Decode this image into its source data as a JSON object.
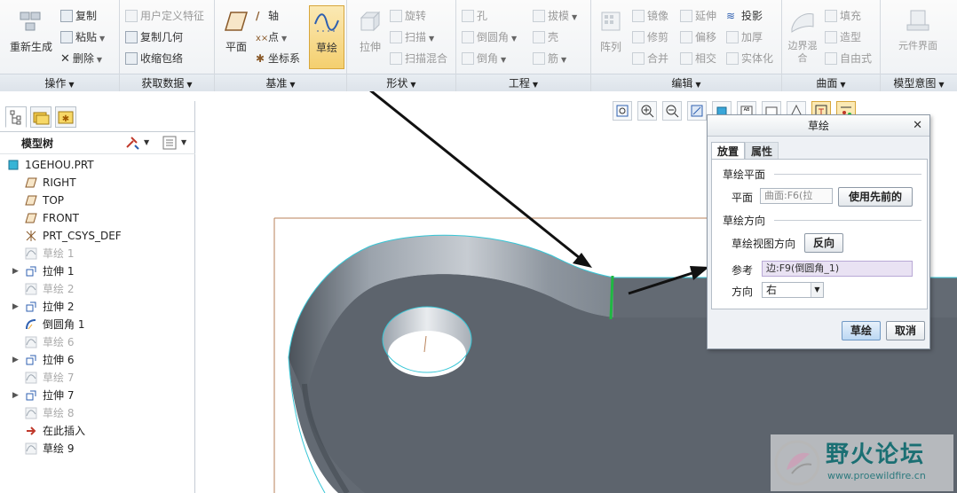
{
  "ribbon": {
    "groups": {
      "operations": "操作",
      "get_data": "获取数据",
      "datum": "基准",
      "shapes": "形状",
      "engineering": "工程",
      "editing": "编辑",
      "surfaces": "曲面",
      "model_intent": "模型意图"
    },
    "operations": {
      "regenerate": "重新生成",
      "copy": "复制",
      "paste": "粘贴",
      "delete": "删除"
    },
    "get_data": {
      "udf": "用户定义特征",
      "copy_geom": "复制几何",
      "shrinkwrap": "收缩包络"
    },
    "datum": {
      "plane": "平面",
      "axis": "轴",
      "point": "点",
      "csys": "坐标系",
      "sketch": "草绘"
    },
    "shapes": {
      "extrude": "拉伸",
      "revolve": "旋转",
      "sweep": "扫描",
      "swept_blend": "扫描混合"
    },
    "engineering": {
      "hole": "孔",
      "draft": "拔模",
      "round": "倒圆角",
      "shell": "壳",
      "chamfer": "倒角",
      "rib": "筋"
    },
    "editing": {
      "pattern": "阵列",
      "mirror": "镜像",
      "extend": "延伸",
      "project": "投影",
      "trim": "修剪",
      "offset": "偏移",
      "thicken": "加厚",
      "merge": "合并",
      "intersect": "相交",
      "solidify": "实体化"
    },
    "surfaces": {
      "boundary_blend": "边界混合",
      "fill": "填充",
      "style": "造型",
      "freestyle": "自由式"
    },
    "model_intent": {
      "component_interface": "元件界面"
    }
  },
  "model_tree": {
    "header": "模型树",
    "items": [
      {
        "label": "1GEHOU.PRT",
        "dim": false,
        "expandable": false
      },
      {
        "label": "RIGHT",
        "dim": false,
        "expandable": false
      },
      {
        "label": "TOP",
        "dim": false,
        "expandable": false
      },
      {
        "label": "FRONT",
        "dim": false,
        "expandable": false
      },
      {
        "label": "PRT_CSYS_DEF",
        "dim": false,
        "expandable": false
      },
      {
        "label": "草绘 1",
        "dim": true,
        "expandable": false
      },
      {
        "label": "拉伸 1",
        "dim": false,
        "expandable": true
      },
      {
        "label": "草绘 2",
        "dim": true,
        "expandable": false
      },
      {
        "label": "拉伸 2",
        "dim": false,
        "expandable": true
      },
      {
        "label": "倒圆角 1",
        "dim": false,
        "expandable": false
      },
      {
        "label": "草绘 6",
        "dim": true,
        "expandable": false
      },
      {
        "label": "拉伸 6",
        "dim": false,
        "expandable": true
      },
      {
        "label": "草绘 7",
        "dim": true,
        "expandable": false
      },
      {
        "label": "拉伸 7",
        "dim": false,
        "expandable": true
      },
      {
        "label": "草绘 8",
        "dim": true,
        "expandable": false
      },
      {
        "label": "在此插入",
        "dim": false,
        "expandable": false
      },
      {
        "label": "草绘 9",
        "dim": false,
        "expandable": false
      }
    ]
  },
  "dialog": {
    "title": "草绘",
    "tab_placement": "放置",
    "tab_properties": "属性",
    "sketch_plane_section": "草绘平面",
    "plane_label": "平面",
    "plane_value": "曲面:F6(拉",
    "use_previous_button": "使用先前的",
    "sketch_orientation_section": "草绘方向",
    "view_direction_label": "草绘视图方向",
    "flip_button": "反向",
    "reference_label": "参考",
    "reference_value": "边:F9(倒圆角_1)",
    "orientation_label": "方向",
    "orientation_value": "右",
    "sketch_button": "草绘",
    "cancel_button": "取消"
  },
  "watermark": {
    "title": "野火论坛",
    "url": "www.proewildfire.cn"
  },
  "colors": {
    "model_gray": "#5e6670",
    "model_top": "#646b74",
    "highlight_cyan": "#37c6d6",
    "edge_green": "#1fb842",
    "datum_brown": "#b9825a",
    "selected_yellow": "#f4cf6f"
  }
}
